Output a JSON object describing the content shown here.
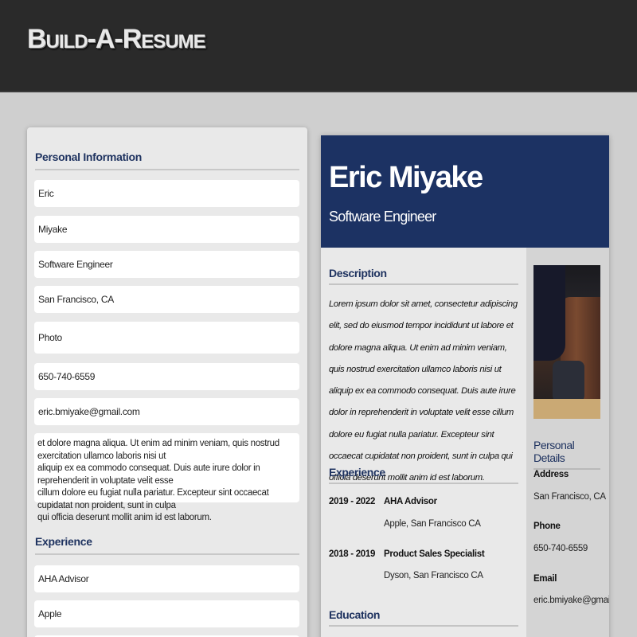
{
  "app": {
    "logo_text": "Build-A-Resume"
  },
  "editor": {
    "personal_heading": "Personal Information",
    "fields": {
      "first_name": "Eric",
      "last_name": "Miyake",
      "job_title": "Software Engineer",
      "location": "San Francisco, CA",
      "photo": "Photo",
      "phone": "650-740-6559",
      "email": "eric.bmiyake@gmail.com"
    },
    "description_lines": [
      "et dolore magna aliqua. Ut enim ad minim veniam, quis nostrud exercitation ullamco laboris nisi ut",
      "aliquip ex ea commodo consequat. Duis aute irure dolor in reprehenderit in voluptate velit esse",
      "cillum dolore eu fugiat nulla pariatur. Excepteur sint occaecat cupidatat non proident, sunt in culpa",
      "qui officia deserunt mollit anim id est laborum."
    ],
    "experience_heading": "Experience",
    "experience_fields": {
      "role": "AHA Advisor",
      "company": "Apple"
    }
  },
  "preview": {
    "name": "Eric Miyake",
    "title": "Software Engineer",
    "description_heading": "Description",
    "description": "Lorem ipsum dolor sit amet, consectetur adipiscing elit, sed do eiusmod tempor incididunt ut labore et dolore magna aliqua. Ut enim ad minim veniam, quis nostrud exercitation ullamco laboris nisi ut aliquip ex ea commodo consequat. Duis aute irure dolor in reprehenderit in voluptate velit esse cillum dolore eu fugiat nulla pariatur. Excepteur sint occaecat cupidatat non proident, sunt in culpa qui officia deserunt mollit anim id est laborum.",
    "experience_heading": "Experience",
    "experience": [
      {
        "years": "2019 - 2022",
        "role": "AHA Advisor",
        "org": "Apple, San Francisco CA"
      },
      {
        "years": "2018 - 2019",
        "role": "Product Sales Specialist",
        "org": "Dyson, San Francisco CA"
      }
    ],
    "education_heading": "Education",
    "sidebar": {
      "details_heading": "Personal Details",
      "address_label": "Address",
      "address": "San Francisco, CA",
      "phone_label": "Phone",
      "phone": "650-740-6559",
      "email_label": "Email",
      "email": "eric.bmiyake@gmail.com"
    }
  },
  "colors": {
    "header_bg": "#2a2a2a",
    "banner_bg": "#1c3263",
    "heading_text": "#1f3360",
    "page_bg": "#cfcfcf"
  }
}
